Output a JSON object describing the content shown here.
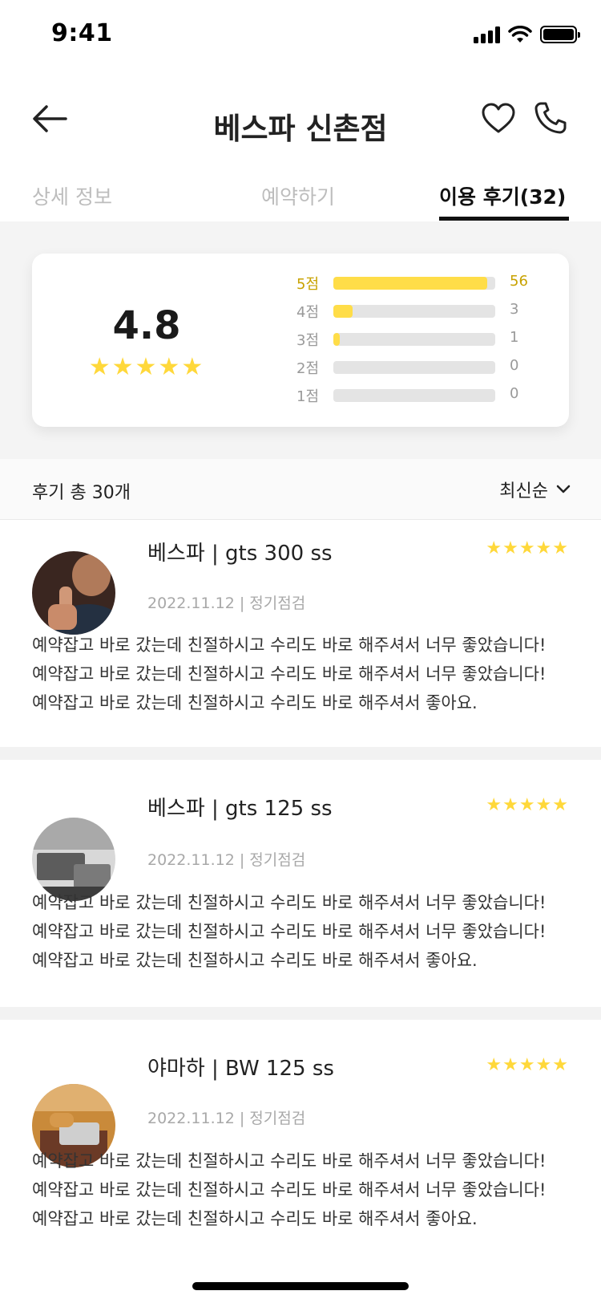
{
  "status_bar": {
    "time": "9:41"
  },
  "header": {
    "title": "베스파 신촌점"
  },
  "tabs": [
    {
      "label": "상세 정보"
    },
    {
      "label": "예약하기"
    },
    {
      "label": "이용 후기(32)"
    }
  ],
  "summary": {
    "average": "4.8",
    "stars": "★★★★★",
    "distribution": [
      {
        "label": "5점",
        "count": "56",
        "ratio": 0.95
      },
      {
        "label": "4점",
        "count": "3",
        "ratio": 0.12
      },
      {
        "label": "3점",
        "count": "1",
        "ratio": 0.04
      },
      {
        "label": "2점",
        "count": "0",
        "ratio": 0
      },
      {
        "label": "1점",
        "count": "0",
        "ratio": 0
      }
    ]
  },
  "list_header": {
    "total": "후기 총 30개",
    "sort": "최신순"
  },
  "reviews": [
    {
      "product": "베스파 | gts 300 ss",
      "stars": "★★★★★",
      "meta": "2022.11.12 | 정기점검",
      "body": "예약잡고 바로 갔는데 친절하시고 수리도 바로 해주셔서 너무 좋았습니다! 예약잡고 바로 갔는데 친절하시고 수리도 바로 해주셔서 너무 좋았습니다! 예약잡고 바로 갔는데 친절하시고 수리도 바로 해주셔서 좋아요."
    },
    {
      "product": "베스파 | gts 125 ss",
      "stars": "★★★★★",
      "meta": "2022.11.12 | 정기점검",
      "body": "예약잡고 바로 갔는데 친절하시고 수리도 바로 해주셔서 너무 좋았습니다! 예약잡고 바로 갔는데 친절하시고 수리도 바로 해주셔서 너무 좋았습니다! 예약잡고 바로 갔는데 친절하시고 수리도 바로 해주셔서 좋아요."
    },
    {
      "product": "야마하 | BW 125 ss",
      "stars": "★★★★★",
      "meta": "2022.11.12 | 정기점검",
      "body": "예약잡고 바로 갔는데 친절하시고 수리도 바로 해주셔서 너무 좋았습니다! 예약잡고 바로 갔는데 친절하시고 수리도 바로 해주셔서 너무 좋았습니다! 예약잡고 바로 갔는데 친절하시고 수리도 바로 해주셔서 좋아요."
    }
  ],
  "colors": {
    "star": "#ffd83a",
    "bar_fill": "#ffdd48",
    "bar_track": "#e4e4e4",
    "active_tab": "#111111"
  }
}
